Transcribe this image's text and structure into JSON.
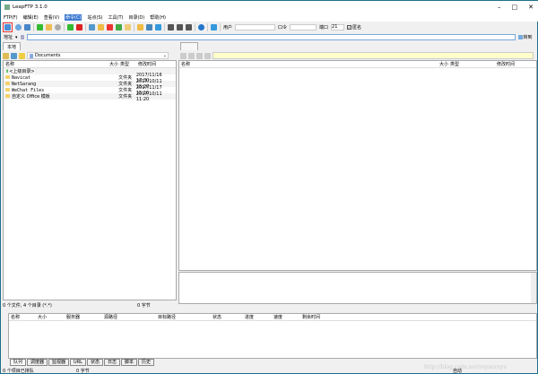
{
  "window": {
    "title": "LeapFTP 3.1.0"
  },
  "menu": [
    {
      "label": "FTP(F)"
    },
    {
      "label": "编辑(E)"
    },
    {
      "label": "查看(V)"
    },
    {
      "label": "命令(C)",
      "active": true
    },
    {
      "label": "站点(S)"
    },
    {
      "label": "工具(T)"
    },
    {
      "label": "目录(D)"
    },
    {
      "label": "帮助(H)"
    }
  ],
  "toolbar": {
    "user_label": "用户",
    "user_value": "",
    "password_label": "口令",
    "password_value": "",
    "port_label": "端口",
    "port_value": "21",
    "anonymous_label": "匿名",
    "anonymous_checked": true
  },
  "address": {
    "label": "地址",
    "value": "",
    "go_label": "转到"
  },
  "local": {
    "tab": "本地",
    "path": "Documents",
    "columns": [
      "名称",
      "大小",
      "类型",
      "修改时间"
    ],
    "rows": [
      {
        "name": "<上级目录>",
        "size": "",
        "type": "",
        "modified": "",
        "icon": "up-arrow-icon"
      },
      {
        "name": "Navicat",
        "size": "",
        "type": "文件夹",
        "modified": "2017/11/16 17:30"
      },
      {
        "name": "NetSarang",
        "size": "",
        "type": "文件夹",
        "modified": "2017/10/11 15:27"
      },
      {
        "name": "WeChat Files",
        "size": "",
        "type": "文件夹",
        "modified": "2017/11/17 15:16"
      },
      {
        "name": "自定义 Office 模板",
        "size": "",
        "type": "文件夹",
        "modified": "2017/10/11 11:20"
      }
    ],
    "status_files": "0 个文件, 4 个目录 (*.*)",
    "status_bytes": "0 字节"
  },
  "remote": {
    "columns": [
      "名称",
      "大小",
      "类型",
      "修改时间"
    ]
  },
  "queue": {
    "columns": [
      "名称",
      "大小",
      "服务器",
      "源路径",
      "目标路径",
      "状态",
      "进度",
      "速度",
      "剩余时间"
    ],
    "tabs": [
      "队列",
      "调度器",
      "监视器",
      "URL",
      "状态",
      "日志",
      "脚本",
      "历史"
    ]
  },
  "statusbar": {
    "queued": "0 个项目已排队",
    "bytes": "0 字节",
    "mode": "自动"
  },
  "watermark": "http://blog.csdn.net/raynorxyx"
}
